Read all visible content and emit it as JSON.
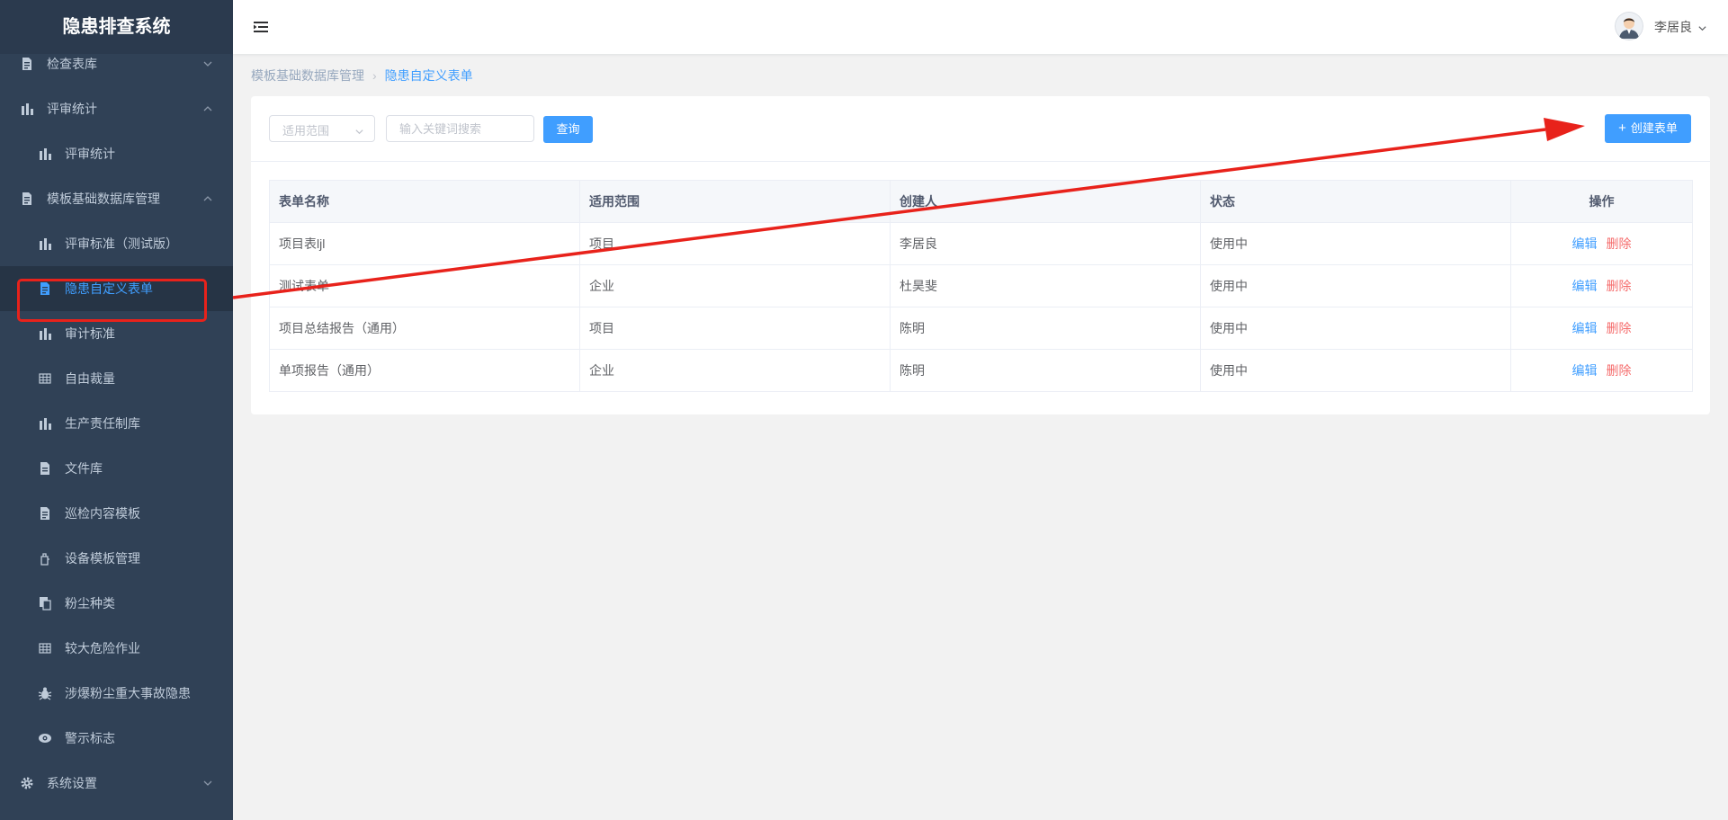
{
  "app": {
    "title": "隐患排查系统"
  },
  "sidebar": {
    "items": [
      {
        "label": "检查表库",
        "icon": "document-icon",
        "level": 1,
        "arrow": "down"
      },
      {
        "label": "评审统计",
        "icon": "bar-chart-icon",
        "level": 1,
        "arrow": "up"
      },
      {
        "label": "评审统计",
        "icon": "bar-chart-icon",
        "level": 2
      },
      {
        "label": "模板基础数据库管理",
        "icon": "document-icon",
        "level": 1,
        "arrow": "up"
      },
      {
        "label": "评审标准（测试版）",
        "icon": "bar-chart-icon",
        "level": 2
      },
      {
        "label": "隐患自定义表单",
        "icon": "document-icon",
        "level": 2,
        "active": true
      },
      {
        "label": "审计标准",
        "icon": "bar-chart-icon",
        "level": 2
      },
      {
        "label": "自由裁量",
        "icon": "table-icon",
        "level": 2
      },
      {
        "label": "生产责任制库",
        "icon": "bar-chart-icon",
        "level": 2
      },
      {
        "label": "文件库",
        "icon": "file-icon",
        "level": 2
      },
      {
        "label": "巡检内容模板",
        "icon": "document-icon",
        "level": 2
      },
      {
        "label": "设备模板管理",
        "icon": "device-icon",
        "level": 2
      },
      {
        "label": "粉尘种类",
        "icon": "copy-icon",
        "level": 2
      },
      {
        "label": "较大危险作业",
        "icon": "table-icon",
        "level": 2
      },
      {
        "label": "涉爆粉尘重大事故隐患",
        "icon": "bug-icon",
        "level": 2
      },
      {
        "label": "警示标志",
        "icon": "eye-icon",
        "level": 2
      },
      {
        "label": "系统设置",
        "icon": "gear-icon",
        "level": 1,
        "arrow": "down"
      }
    ]
  },
  "header": {
    "user_name": "李居良"
  },
  "breadcrumb": {
    "parent": "模板基础数据库管理",
    "current": "隐患自定义表单"
  },
  "toolbar": {
    "scope_placeholder": "适用范围",
    "keyword_placeholder": "输入关键词搜索",
    "query_label": "查询",
    "create_label": "创建表单"
  },
  "table": {
    "columns": [
      "表单名称",
      "适用范围",
      "创建人",
      "状态",
      "操作"
    ],
    "rows": [
      {
        "name": "项目表ljl",
        "scope": "项目",
        "creator": "李居良",
        "status": "使用中"
      },
      {
        "name": "测试表单",
        "scope": "企业",
        "creator": "杜昊斐",
        "status": "使用中"
      },
      {
        "name": "项目总结报告（通用）",
        "scope": "项目",
        "creator": "陈明",
        "status": "使用中"
      },
      {
        "name": "单项报告（通用）",
        "scope": "企业",
        "creator": "陈明",
        "status": "使用中"
      }
    ],
    "edit_label": "编辑",
    "delete_label": "删除"
  },
  "colors": {
    "sidebar_bg": "#304156",
    "sidebar_active": "#409eff",
    "primary": "#409eff",
    "danger": "#f56c6c",
    "annotation": "#e8221b"
  }
}
